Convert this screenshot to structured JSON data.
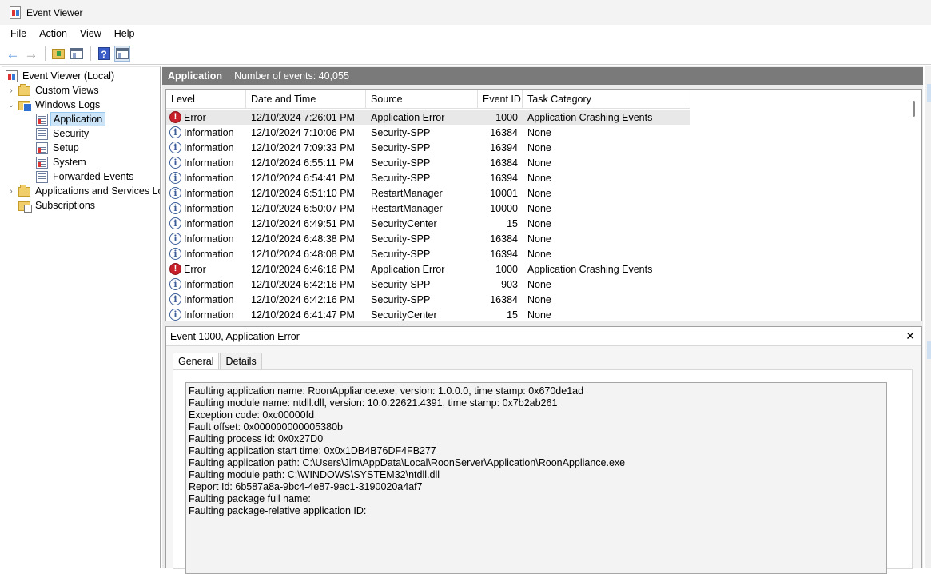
{
  "window": {
    "title": "Event Viewer"
  },
  "menu": [
    "File",
    "Action",
    "View",
    "Help"
  ],
  "tree": {
    "root": "Event Viewer (Local)",
    "custom_views": "Custom Views",
    "windows_logs": "Windows Logs",
    "logs": [
      "Application",
      "Security",
      "Setup",
      "System",
      "Forwarded Events"
    ],
    "apps_services": "Applications and Services Lo",
    "subscriptions": "Subscriptions",
    "selected": "Application"
  },
  "header": {
    "title": "Application",
    "count": "Number of events: 40,055"
  },
  "columns": [
    "Level",
    "Date and Time",
    "Source",
    "Event ID",
    "Task Category"
  ],
  "events": [
    {
      "level": "Error",
      "date": "12/10/2024 7:26:01 PM",
      "source": "Application Error",
      "id": "1000",
      "category": "Application Crashing Events"
    },
    {
      "level": "Information",
      "date": "12/10/2024 7:10:06 PM",
      "source": "Security-SPP",
      "id": "16384",
      "category": "None"
    },
    {
      "level": "Information",
      "date": "12/10/2024 7:09:33 PM",
      "source": "Security-SPP",
      "id": "16394",
      "category": "None"
    },
    {
      "level": "Information",
      "date": "12/10/2024 6:55:11 PM",
      "source": "Security-SPP",
      "id": "16384",
      "category": "None"
    },
    {
      "level": "Information",
      "date": "12/10/2024 6:54:41 PM",
      "source": "Security-SPP",
      "id": "16394",
      "category": "None"
    },
    {
      "level": "Information",
      "date": "12/10/2024 6:51:10 PM",
      "source": "RestartManager",
      "id": "10001",
      "category": "None"
    },
    {
      "level": "Information",
      "date": "12/10/2024 6:50:07 PM",
      "source": "RestartManager",
      "id": "10000",
      "category": "None"
    },
    {
      "level": "Information",
      "date": "12/10/2024 6:49:51 PM",
      "source": "SecurityCenter",
      "id": "15",
      "category": "None"
    },
    {
      "level": "Information",
      "date": "12/10/2024 6:48:38 PM",
      "source": "Security-SPP",
      "id": "16384",
      "category": "None"
    },
    {
      "level": "Information",
      "date": "12/10/2024 6:48:08 PM",
      "source": "Security-SPP",
      "id": "16394",
      "category": "None"
    },
    {
      "level": "Error",
      "date": "12/10/2024 6:46:16 PM",
      "source": "Application Error",
      "id": "1000",
      "category": "Application Crashing Events"
    },
    {
      "level": "Information",
      "date": "12/10/2024 6:42:16 PM",
      "source": "Security-SPP",
      "id": "903",
      "category": "None"
    },
    {
      "level": "Information",
      "date": "12/10/2024 6:42:16 PM",
      "source": "Security-SPP",
      "id": "16384",
      "category": "None"
    },
    {
      "level": "Information",
      "date": "12/10/2024 6:41:47 PM",
      "source": "SecurityCenter",
      "id": "15",
      "category": "None"
    }
  ],
  "detail": {
    "title": "Event 1000, Application Error",
    "tabs": [
      "General",
      "Details"
    ],
    "lines": [
      "Faulting application name: RoonAppliance.exe, version: 1.0.0.0, time stamp: 0x670de1ad",
      "Faulting module name: ntdll.dll, version: 10.0.22621.4391, time stamp: 0x7b2ab261",
      "Exception code: 0xc00000fd",
      "Fault offset: 0x000000000005380b",
      "Faulting process id: 0x0x27D0",
      "Faulting application start time: 0x0x1DB4B76DF4FB277",
      "Faulting application path: C:\\Users\\Jim\\AppData\\Local\\RoonServer\\Application\\RoonAppliance.exe",
      "Faulting module path: C:\\WINDOWS\\SYSTEM32\\ntdll.dll",
      "Report Id: 6b587a8a-9bc4-4e87-9ac1-3190020a4af7",
      "Faulting package full name: ",
      "Faulting package-relative application ID: "
    ]
  }
}
